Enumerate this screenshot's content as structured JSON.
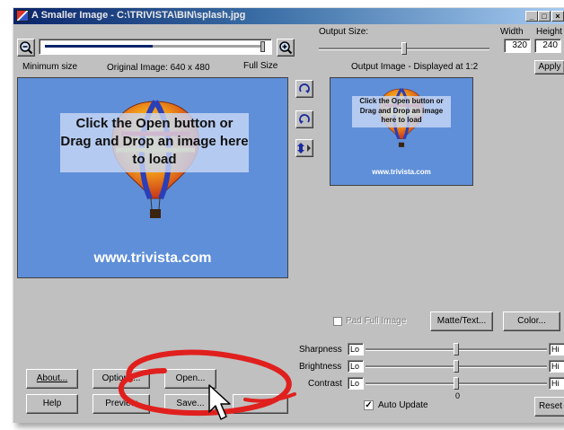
{
  "window": {
    "title": "A Smaller Image - C:\\TRIVISTA\\BIN\\splash.jpg",
    "min_glyph": "_",
    "max_glyph": "□",
    "close_glyph": "×"
  },
  "zoom": {
    "min_label": "Minimum size",
    "original_label": "Original Image: 640 x 480",
    "full_label": "Full Size"
  },
  "output": {
    "size_label": "Output Size:",
    "width_label": "Width",
    "height_label": "Height",
    "width_value": "320",
    "height_value": "240",
    "apply_label": "Apply",
    "display_label": "Output Image - Displayed at 1:2"
  },
  "preview": {
    "main_text": "Click the Open button or Drag and Drop an image here to load",
    "url": "www.trivista.com",
    "small_text": "Click the Open button or Drag and Drop an image here to load",
    "small_url": "www.trivista.com"
  },
  "options": {
    "pad_label": "Pad Full Image",
    "matte_label": "Matte/Text...",
    "color_label": "Color..."
  },
  "adjust": {
    "sharpness_label": "Sharpness",
    "brightness_label": "Brightness",
    "contrast_label": "Contrast",
    "lo": "Lo",
    "hi": "Hi",
    "zero": "0",
    "auto_update_label": "Auto Update",
    "reset_label": "Reset"
  },
  "buttons": {
    "about": "About...",
    "options": "Options...",
    "open": "Open...",
    "help": "Help",
    "preview": "Preview",
    "save": "Save..."
  },
  "colors": {
    "annotation": "#e0201e",
    "panel_blue": "#5f8fd8"
  }
}
